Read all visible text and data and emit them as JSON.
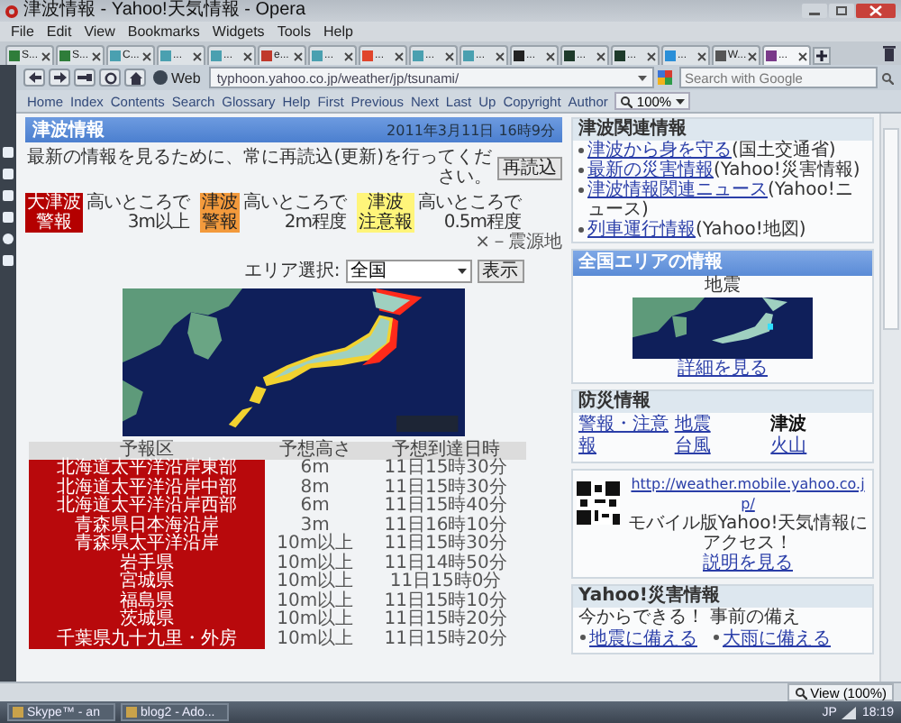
{
  "window": {
    "title": "津波情報 - Yahoo!天気情報 - Opera"
  },
  "menu": [
    "File",
    "Edit",
    "View",
    "Bookmarks",
    "Widgets",
    "Tools",
    "Help"
  ],
  "tabs": [
    {
      "label": "S...",
      "selected": false
    },
    {
      "label": "S...",
      "selected": false
    },
    {
      "label": "C...",
      "selected": false
    },
    {
      "label": "...",
      "selected": false
    },
    {
      "label": "...",
      "selected": false
    },
    {
      "label": "e...",
      "selected": false
    },
    {
      "label": "...",
      "selected": false
    },
    {
      "label": "...",
      "selected": false
    },
    {
      "label": "...",
      "selected": false
    },
    {
      "label": "...",
      "selected": false
    },
    {
      "label": "...",
      "selected": false
    },
    {
      "label": "...",
      "selected": false
    },
    {
      "label": "...",
      "selected": false
    },
    {
      "label": "...",
      "selected": false
    },
    {
      "label": "W...",
      "selected": false
    },
    {
      "label": "...",
      "selected": true
    }
  ],
  "address_bar": {
    "web_label": "Web",
    "url": "typhoon.yahoo.co.jp/weather/jp/tsunami/",
    "search_placeholder": "Search with Google"
  },
  "nav_links": [
    "Home",
    "Index",
    "Contents",
    "Search",
    "Glossary",
    "Help",
    "First",
    "Previous",
    "Next",
    "Last",
    "Up",
    "Copyright",
    "Author"
  ],
  "zoom": "100%",
  "page": {
    "title": "津波情報",
    "updated": "2011年3月11日 16時9分",
    "notice": "最新の情報を見るために、常に再読込(更新)を行ってください。",
    "reload_button": "再読込",
    "legend": [
      {
        "kind": "major",
        "label_lines": [
          "大津波",
          "警報"
        ],
        "height_lines": [
          "高いところで",
          "3m以上"
        ]
      },
      {
        "kind": "warning",
        "label_lines": [
          "津波",
          "警報"
        ],
        "height_lines": [
          "高いところで",
          "2m程度"
        ]
      },
      {
        "kind": "advisory",
        "label_lines": [
          "津波",
          "注意報"
        ],
        "height_lines": [
          "高いところで",
          "0.5m程度"
        ]
      }
    ],
    "epicenter_note": "×－震源地",
    "area_label": "エリア選択:",
    "area_value": "全国",
    "show_button": "表示",
    "table": {
      "columns": [
        "予報区",
        "予想高さ",
        "予想到達日時"
      ],
      "rows": [
        [
          "北海道太平洋沿岸東部",
          "6m",
          "11日15時30分"
        ],
        [
          "北海道太平洋沿岸中部",
          "8m",
          "11日15時30分"
        ],
        [
          "北海道太平洋沿岸西部",
          "6m",
          "11日15時40分"
        ],
        [
          "青森県日本海沿岸",
          "3m",
          "11日16時10分"
        ],
        [
          "青森県太平洋沿岸",
          "10m以上",
          "11日15時30分"
        ],
        [
          "岩手県",
          "10m以上",
          "11日14時50分"
        ],
        [
          "宮城県",
          "10m以上",
          "11日15時0分"
        ],
        [
          "福島県",
          "10m以上",
          "11日15時10分"
        ],
        [
          "茨城県",
          "10m以上",
          "11日15時20分"
        ],
        [
          "千葉県九十九里・外房",
          "10m以上",
          "11日15時20分"
        ]
      ]
    }
  },
  "related": {
    "title": "津波関連情報",
    "links": [
      {
        "link": "津波から身を守る",
        "source": "(国土交通省)"
      },
      {
        "link": "最新の災害情報",
        "source": "(Yahoo!災害情報)"
      },
      {
        "link": "津波情報関連ニュース",
        "source": "(Yahoo!ニュース)"
      },
      {
        "link": "列車運行情報",
        "source": "(Yahoo!地図)"
      }
    ]
  },
  "nationwide": {
    "title": "全国エリアの情報",
    "map_caption": "地震",
    "more_link": "詳細を見る"
  },
  "disaster_prevention": {
    "title": "防災情報",
    "items": [
      {
        "label": "警報・注意報",
        "selected": false
      },
      {
        "label": "地震",
        "selected": false
      },
      {
        "label": "津波",
        "selected": true
      },
      {
        "label": "台風",
        "selected": false
      },
      {
        "label": "火山",
        "selected": false
      }
    ]
  },
  "mobile": {
    "url": "http://weather.mobile.yahoo.co.jp/",
    "text": "モバイル版Yahoo!天気情報にアクセス！",
    "help_link": "説明を見る"
  },
  "yahoo_disaster": {
    "title": "Yahoo!災害情報",
    "subtitle": "今からできる！ 事前の備え",
    "links": [
      "地震に備える",
      "大雨に備える"
    ]
  },
  "status_bar": {
    "view": "View (100%)"
  },
  "taskbar": {
    "items": [
      "Skype™ - an",
      "blog2 - Ado..."
    ],
    "language": "JP",
    "clock": "18:19"
  }
}
